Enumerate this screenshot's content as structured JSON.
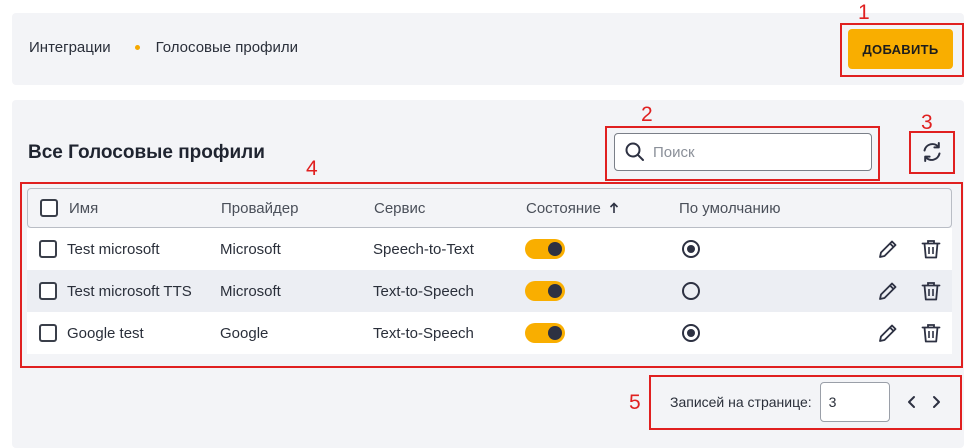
{
  "breadcrumb": {
    "items": [
      "Интеграции",
      "Голосовые профили"
    ]
  },
  "header": {
    "add_label": "ДОБАВИТЬ"
  },
  "main": {
    "title": "Все Голосовые профили"
  },
  "search": {
    "placeholder": "Поиск",
    "value": ""
  },
  "table": {
    "columns": [
      "Имя",
      "Провайдер",
      "Сервис",
      "Состояние",
      "По умолчанию"
    ],
    "sort_column": "Состояние",
    "rows": [
      {
        "name": "Test microsoft",
        "provider": "Microsoft",
        "service": "Speech-to-Text",
        "enabled": true,
        "default": true
      },
      {
        "name": "Test microsoft TTS",
        "provider": "Microsoft",
        "service": "Text-to-Speech",
        "enabled": true,
        "default": false
      },
      {
        "name": "Google test",
        "provider": "Google",
        "service": "Text-to-Speech",
        "enabled": true,
        "default": true
      }
    ]
  },
  "pagination": {
    "label": "Записей на странице:",
    "page_size": "3"
  },
  "annotations": [
    "1",
    "2",
    "3",
    "4",
    "5"
  ],
  "colors": {
    "accent": "#f9ae00",
    "annotation": "#e02020",
    "card": "#f3f4f7"
  },
  "icons": [
    "search-icon",
    "refresh-icon",
    "edit-icon",
    "trash-icon",
    "chevron-left-icon",
    "chevron-right-icon",
    "sort-up-icon"
  ]
}
